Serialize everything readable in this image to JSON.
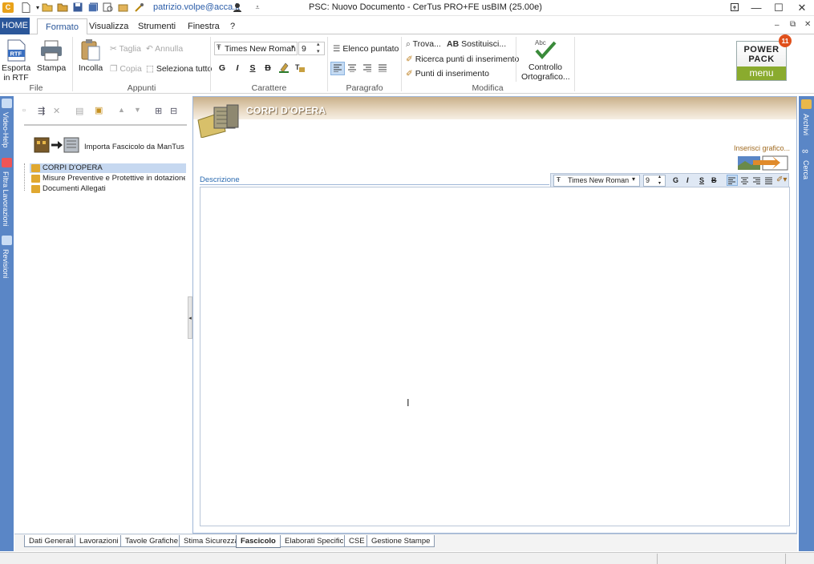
{
  "titlebar": {
    "user_email": "patrizio.volpe@acca.it",
    "title": "PSC: Nuovo Documento - CerTus PRO+FE   usBIM (25.00e)"
  },
  "ribbon_tabs": [
    "HOME",
    "Formato",
    "Visualizza",
    "Strumenti",
    "Finestra",
    "?"
  ],
  "ribbon": {
    "file": {
      "group": "File",
      "export_rtf": "Esporta\nin RTF",
      "print": "Stampa",
      "rtf_badge": "RTF"
    },
    "appunti": {
      "group": "Appunti",
      "paste": "Incolla",
      "cut": "Taglia",
      "undo": "Annulla",
      "copy": "Copia",
      "select_all": "Seleziona tutto"
    },
    "carattere": {
      "group": "Carattere",
      "font": "Times New Roman",
      "size": "9",
      "fmt_buttons": [
        "G",
        "I",
        "S",
        "B"
      ]
    },
    "paragrafo": {
      "group": "Paragrafo",
      "bullet_list": "Elenco puntato"
    },
    "modifica": {
      "group": "Modifica",
      "find": "Trova...",
      "replace": "Sostituisci...",
      "search_points": "Ricerca punti di inserimento",
      "insertion_points": "Punti di inserimento"
    },
    "spellcheck": {
      "label1": "Controllo",
      "label2": "Ortografico..."
    },
    "powerpack": {
      "line1": "POWER",
      "line2": "PACK",
      "menu": "menu",
      "badge": "11"
    }
  },
  "left_sidebar": [
    "Video-Help",
    "Filtra Lavorazioni",
    "Revisioni"
  ],
  "right_sidebar": [
    "Archivi",
    "Cerca"
  ],
  "tree": {
    "import_label": "Importa Fascicolo da ManTus",
    "items": [
      {
        "label": "CORPI D'OPERA",
        "selected": true
      },
      {
        "label": "Misure Preventive e Protettive in dotazione dell",
        "selected": false
      },
      {
        "label": "Documenti Allegati",
        "selected": false
      }
    ]
  },
  "panel": {
    "title": "CORPI D'OPERA",
    "insert_graphic": "Inserisci grafico...",
    "description_label": "Descrizione",
    "editor_font": "Times New Roman",
    "editor_size": "9",
    "editor_fmt": [
      "G",
      "I",
      "S",
      "B"
    ]
  },
  "bottom_tabs": [
    "Dati Generali",
    "Lavorazioni",
    "Tavole Grafiche",
    "Stima Sicurezza",
    "Fascicolo",
    "Elaborati Specifici",
    "CSE",
    "Gestione Stampe"
  ],
  "active_bottom_tab": "Fascicolo",
  "colors": {
    "accent": "#2b579a",
    "sidebar": "#5a86c6",
    "header_brown": "#c9b08a",
    "powerpack_green": "#8aab2e",
    "badge_orange": "#e0501b"
  }
}
